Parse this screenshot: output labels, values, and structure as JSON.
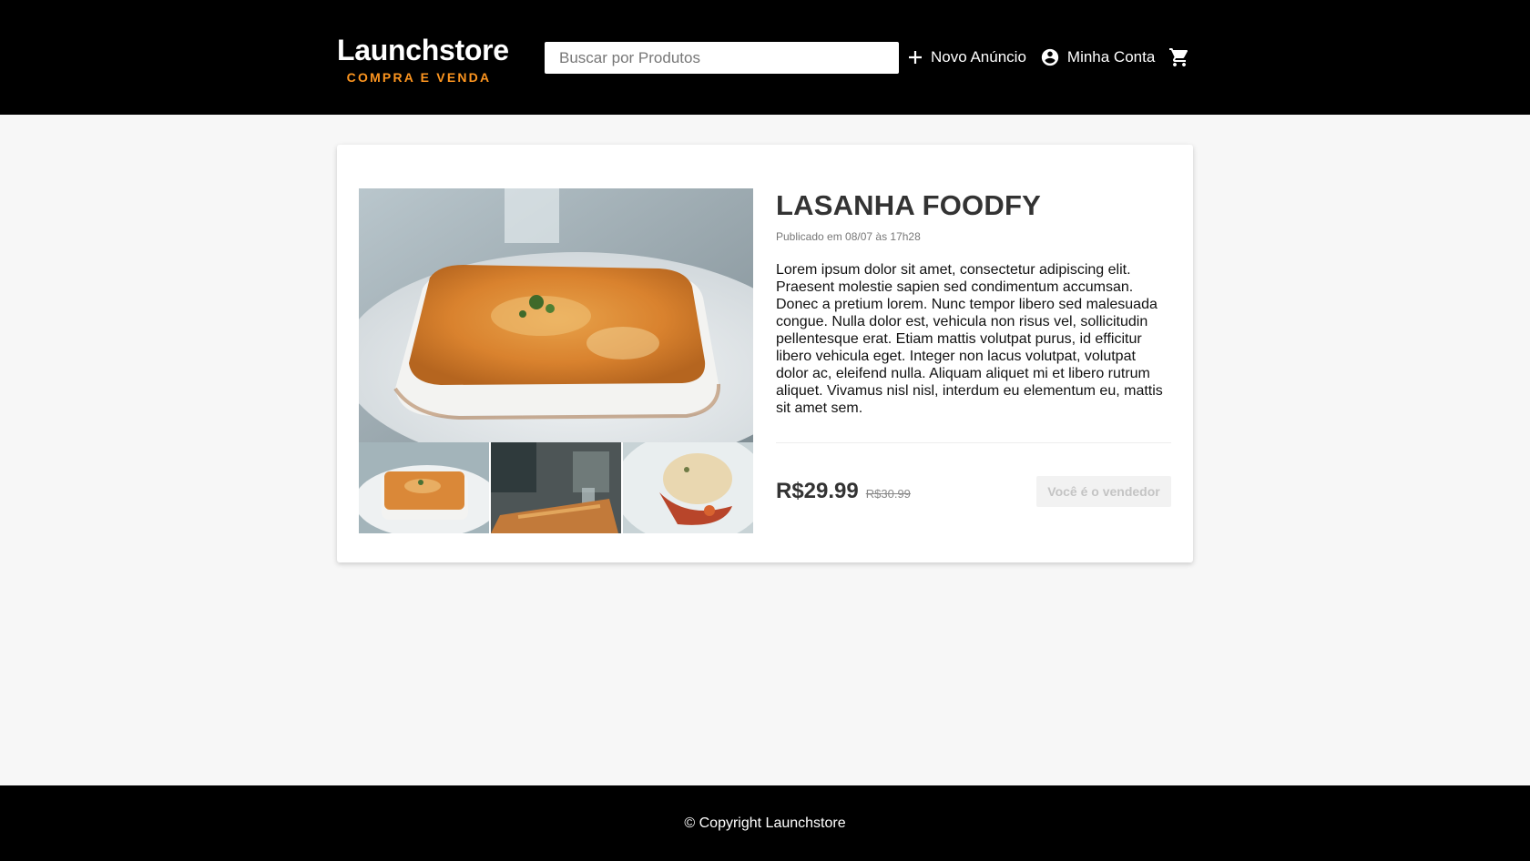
{
  "header": {
    "logo_title": "Launchstore",
    "logo_subtitle": "COMPRA E VENDA",
    "search_placeholder": "Buscar por Produtos",
    "nav": {
      "new_ad": "Novo Anúncio",
      "my_account": "Minha Conta"
    }
  },
  "product": {
    "title": "LASANHA FOODFY",
    "published": "Publicado em 08/07 às 17h28",
    "description": "Lorem ipsum dolor sit amet, consectetur adipiscing elit. Praesent molestie sapien sed condimentum accumsan. Donec a pretium lorem. Nunc tempor libero sed malesuada congue. Nulla dolor est, vehicula non risus vel, sollicitudin pellentesque erat. Etiam mattis volutpat purus, id efficitur libero vehicula eget. Integer non lacus volutpat, volutpat dolor ac, eleifend nulla. Aliquam aliquet mi et libero rutrum aliquet. Vivamus nisl nisl, interdum eu elementum eu, mattis sit amet sem.",
    "price": "R$29.99",
    "old_price": "R$30.99",
    "seller_button": "Você é o vendedor"
  },
  "footer": {
    "copyright": "© Copyright Launchstore"
  },
  "colors": {
    "header_bg": "#000000",
    "accent": "#fd951f",
    "page_bg": "#f7f7f7"
  }
}
